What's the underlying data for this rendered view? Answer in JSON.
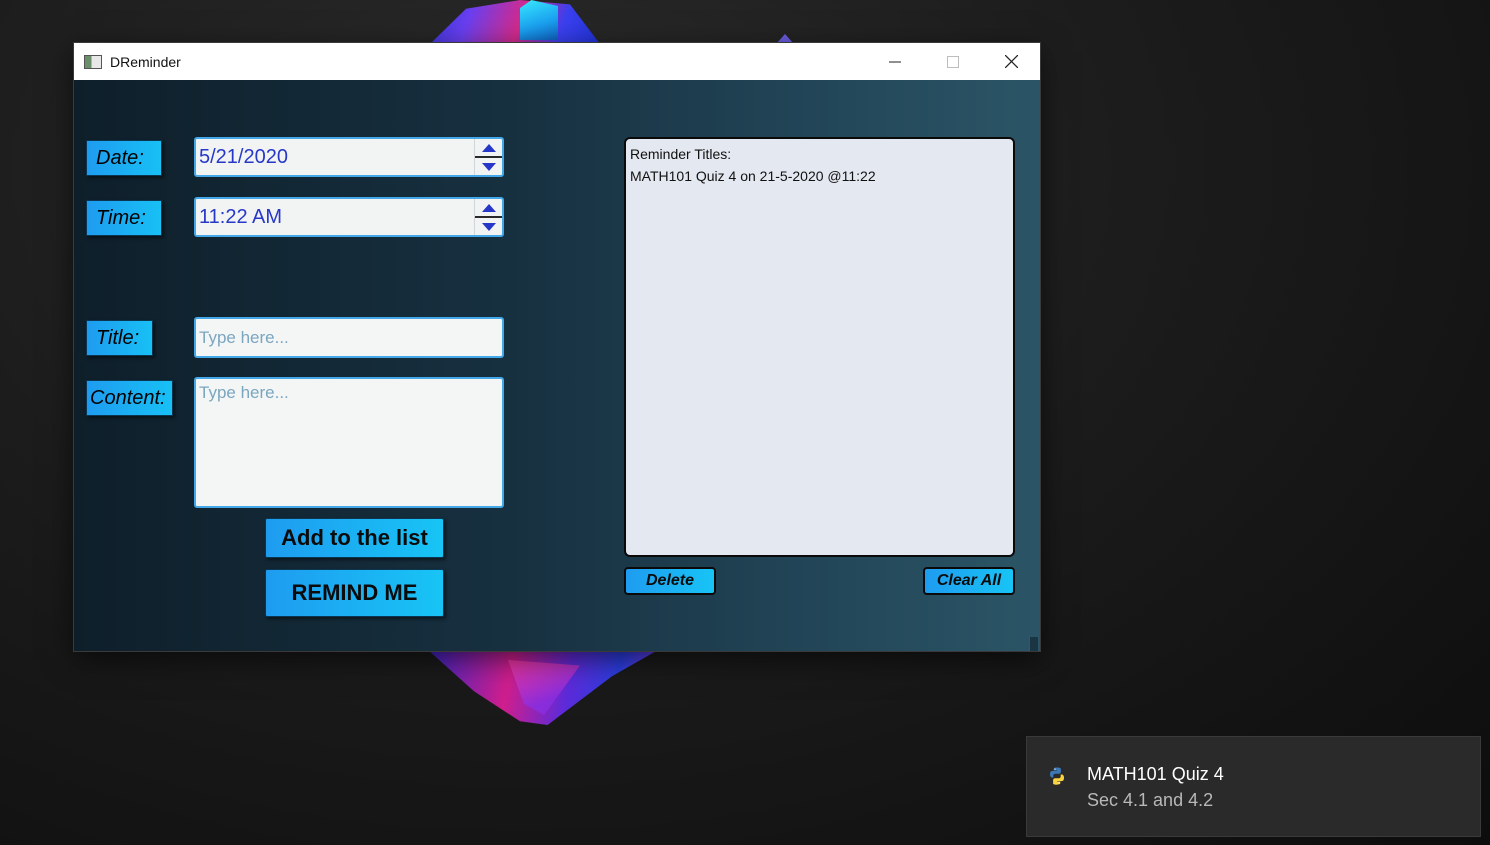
{
  "window": {
    "title": "DReminder",
    "controls": {
      "minimize": "minimize-icon",
      "maximize": "maximize-icon",
      "close": "close-icon"
    }
  },
  "form": {
    "date_label": "Date:",
    "date_value": "5/21/2020",
    "time_label": "Time:",
    "time_value": "11:22 AM",
    "title_label": "Title:",
    "title_placeholder": "Type here...",
    "content_label": "Content:",
    "content_placeholder": "Type here...",
    "add_button": "Add to the list",
    "remind_button": "REMIND ME"
  },
  "reminders": {
    "header": "Reminder Titles:",
    "items": [
      "MATH101 Quiz 4 on 21-5-2020 @11:22"
    ],
    "delete_button": "Delete",
    "clear_button": "Clear All"
  },
  "notification": {
    "app_icon": "python-icon",
    "title": "MATH101 Quiz 4",
    "body": "Sec 4.1 and 4.2"
  },
  "colors": {
    "accent": "#1e9cf0",
    "input_text": "#2738c8",
    "placeholder": "#7aa6c0"
  }
}
